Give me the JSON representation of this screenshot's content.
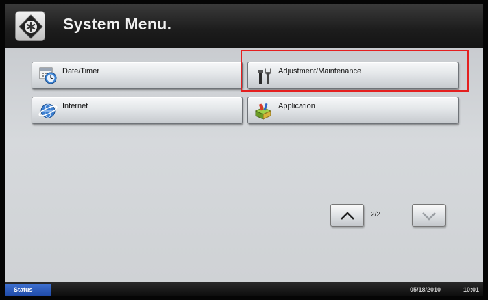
{
  "header": {
    "title": "System Menu."
  },
  "menu": {
    "date_timer": "Date/Timer",
    "adjustment_maintenance": "Adjustment/Maintenance",
    "internet": "Internet",
    "application": "Application"
  },
  "pager": {
    "indicator": "2/2"
  },
  "footer": {
    "status_label": "Status",
    "date": "05/18/2010",
    "time": "10:01"
  },
  "colors": {
    "highlight": "#e41f1f",
    "status_accent": "#1f4aa8",
    "title_bar": "#1c1c1c"
  },
  "icons": {
    "home": "home-asterisk-icon",
    "date_timer": "clock-calendar-icon",
    "adjustment": "wrench-tools-icon",
    "internet": "globe-icon",
    "application": "toolbox-icon",
    "page_up": "chevron-up-icon",
    "page_down": "chevron-down-icon"
  }
}
